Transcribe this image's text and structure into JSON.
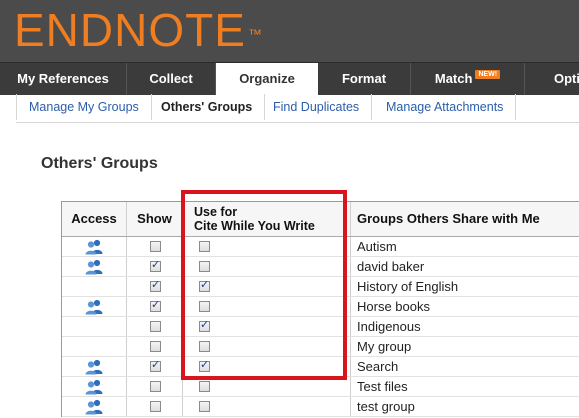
{
  "app": {
    "logo": "ENDNOTE",
    "logo_mark": "™"
  },
  "tabs": [
    {
      "label": "My References",
      "active": false
    },
    {
      "label": "Collect",
      "active": false
    },
    {
      "label": "Organize",
      "active": true
    },
    {
      "label": "Format",
      "active": false
    },
    {
      "label": "Match",
      "badge": "NEW!",
      "active": false
    },
    {
      "label": "Optio",
      "active": false
    }
  ],
  "subnav": [
    {
      "label": "Manage My Groups",
      "active": false
    },
    {
      "label": "Others' Groups",
      "active": true
    },
    {
      "label": "Find Duplicates",
      "active": false
    },
    {
      "label": "Manage Attachments",
      "active": false
    }
  ],
  "page_title": "Others' Groups",
  "table": {
    "headers": {
      "access": "Access",
      "show": "Show",
      "cwyw_line1": "Use for",
      "cwyw_line2": "Cite While You Write",
      "groups": "Groups Others Share with Me"
    },
    "rows": [
      {
        "access": true,
        "show": false,
        "cwyw": false,
        "name": "Autism"
      },
      {
        "access": true,
        "show": true,
        "cwyw": false,
        "name": "david baker"
      },
      {
        "access": false,
        "show": true,
        "cwyw": true,
        "name": "History of English"
      },
      {
        "access": true,
        "show": true,
        "cwyw": false,
        "name": "Horse books"
      },
      {
        "access": false,
        "show": false,
        "cwyw": true,
        "name": "Indigenous"
      },
      {
        "access": false,
        "show": false,
        "cwyw": false,
        "name": "My group"
      },
      {
        "access": true,
        "show": true,
        "cwyw": true,
        "name": "Search"
      },
      {
        "access": true,
        "show": false,
        "cwyw": false,
        "name": "Test files"
      },
      {
        "access": true,
        "show": false,
        "cwyw": false,
        "name": "test group"
      }
    ]
  },
  "colors": {
    "header_bg": "#4b4b4b",
    "nav_bg": "#3b3b3b",
    "logo": "#ef7d22",
    "link": "#2b5ea9",
    "highlight": "#d9141f",
    "access_icon": "#2f6fb8"
  },
  "icons": {
    "access": "people-icon"
  }
}
